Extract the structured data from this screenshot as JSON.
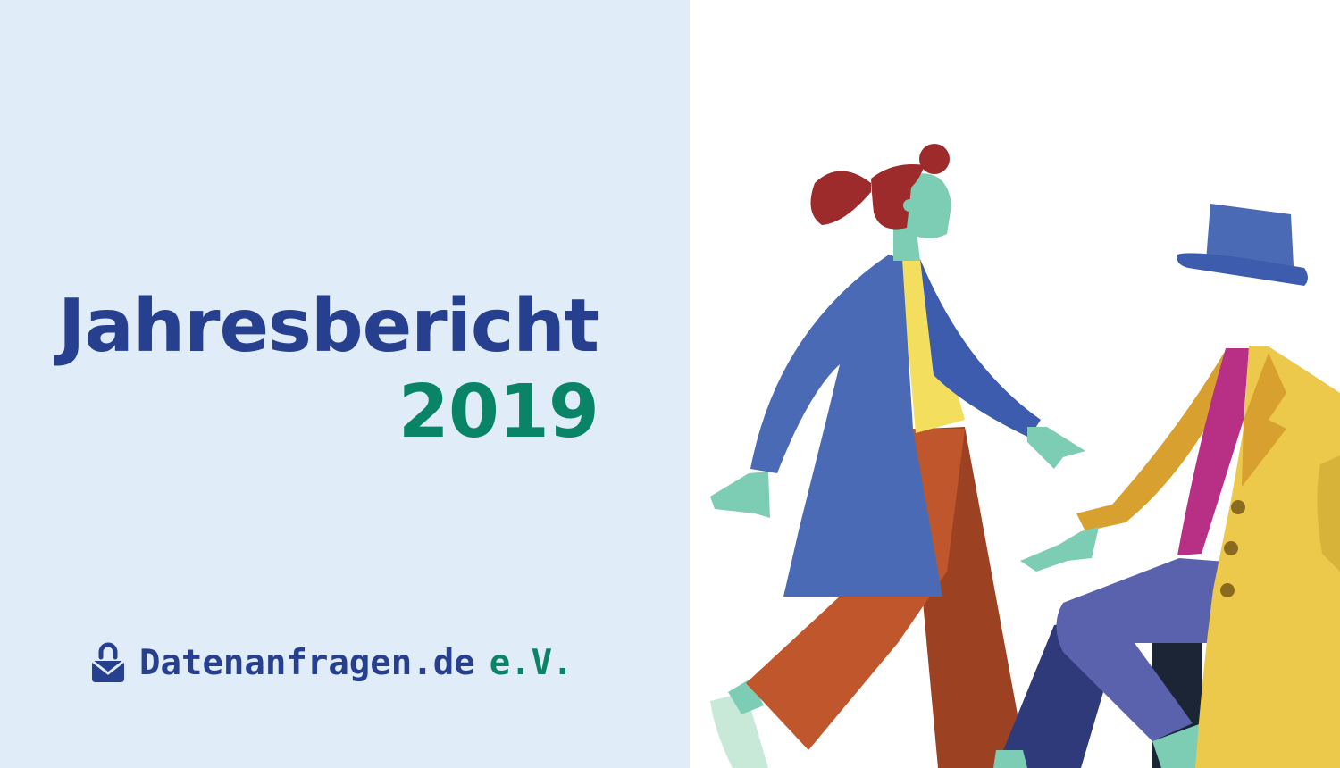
{
  "title": {
    "line1": "Jahresbericht",
    "line2": "2019"
  },
  "logo": {
    "name": "Datenanfragen.de",
    "suffix": "e.V.",
    "icon": "bag-lock-icon"
  },
  "colors": {
    "panel_background": "#e0ecf8",
    "primary_blue": "#26408f",
    "accent_green": "#0a8466"
  },
  "illustration": {
    "subject": "two-walking-people"
  }
}
